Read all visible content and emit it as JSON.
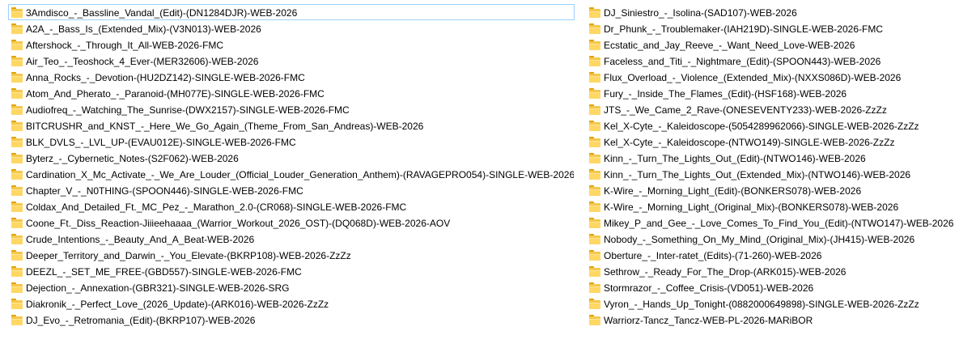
{
  "folder_icon": "folder-icon",
  "colors": {
    "folder": "#ffd765",
    "focus_border": "#99d1ff"
  },
  "focused_item": "3Amdisco_-_Bassline_Vandal_(Edit)-(DN1284DJR)-WEB-2026",
  "column_left": [
    "3Amdisco_-_Bassline_Vandal_(Edit)-(DN1284DJR)-WEB-2026",
    "A2A_-_Bass_Is_(Extended_Mix)-(V3N013)-WEB-2026",
    "Aftershock_-_Through_It_All-WEB-2026-FMC",
    "Air_Teo_-_Teoshock_4_Ever-(MER32606)-WEB-2026",
    "Anna_Rocks_-_Devotion-(HU2DZ142)-SINGLE-WEB-2026-FMC",
    "Atom_And_Pherato_-_Paranoid-(MH077E)-SINGLE-WEB-2026-FMC",
    "Audiofreq_-_Watching_The_Sunrise-(DWX2157)-SINGLE-WEB-2026-FMC",
    "BITCRUSHR_and_KNST_-_Here_We_Go_Again_(Theme_From_San_Andreas)-WEB-2026",
    "BLK_DVLS_-_LVL_UP-(EVAU012E)-SINGLE-WEB-2026-FMC",
    "Byterz_-_Cybernetic_Notes-(S2F062)-WEB-2026",
    "Cardination_X_Mc_Activate_-_We_Are_Louder_(Official_Louder_Generation_Anthem)-(RAVAGEPRO054)-SINGLE-WEB-2026-FMC",
    "Chapter_V_-_N0THING-(SPOON446)-SINGLE-WEB-2026-FMC",
    "Coldax_And_Detailed_Ft._MC_Pez_-_Marathon_2.0-(CR068)-SINGLE-WEB-2026-FMC",
    "Coone_Ft._Diss_Reaction-Jiiieehaaaa_(Warrior_Workout_2026_OST)-(DQ068D)-WEB-2026-AOV",
    "Crude_Intentions_-_Beauty_And_A_Beat-WEB-2026",
    "Deeper_Territory_and_Darwin_-_You_Elevate-(BKRP108)-WEB-2026-ZzZz",
    "DEEZL_-_SET_ME_FREE-(GBD557)-SINGLE-WEB-2026-FMC",
    "Dejection_-_Annexation-(GBR321)-SINGLE-WEB-2026-SRG",
    "Diakronik_-_Perfect_Love_(2026_Update)-(ARK016)-WEB-2026-ZzZz",
    "DJ_Evo_-_Retromania_(Edit)-(BKRP107)-WEB-2026"
  ],
  "column_right": [
    "DJ_Siniestro_-_Isolina-(SAD107)-WEB-2026",
    "Dr_Phunk_-_Troublemaker-(IAH219D)-SINGLE-WEB-2026-FMC",
    "Ecstatic_and_Jay_Reeve_-_Want_Need_Love-WEB-2026",
    "Faceless_and_Titi_-_Nightmare_(Edit)-(SPOON443)-WEB-2026",
    "Flux_Overload_-_Violence_(Extended_Mix)-(NXXS086D)-WEB-2026",
    "Fury_-_Inside_The_Flames_(Edit)-(HSF168)-WEB-2026",
    "JTS_-_We_Came_2_Rave-(ONESEVENTY233)-WEB-2026-ZzZz",
    "Kel_X-Cyte_-_Kaleidoscope-(5054289962066)-SINGLE-WEB-2026-ZzZz",
    "Kel_X-Cyte_-_Kaleidoscope-(NTWO149)-SINGLE-WEB-2026-ZzZz",
    "Kinn_-_Turn_The_Lights_Out_(Edit)-(NTWO146)-WEB-2026",
    "Kinn_-_Turn_The_Lights_Out_(Extended_Mix)-(NTWO146)-WEB-2026",
    "K-Wire_-_Morning_Light_(Edit)-(BONKERS078)-WEB-2026",
    "K-Wire_-_Morning_Light_(Original_Mix)-(BONKERS078)-WEB-2026",
    "Mikey_P_and_Gee_-_Love_Comes_To_Find_You_(Edit)-(NTWO147)-WEB-2026",
    "Nobody_-_Something_On_My_Mind_(Original_Mix)-(JH415)-WEB-2026",
    "Oberture_-_Inter-ratet_(Edits)-(71-260)-WEB-2026",
    "Sethrow_-_Ready_For_The_Drop-(ARK015)-WEB-2026",
    "Stormrazor_-_Coffee_Crisis-(VD051)-WEB-2026",
    "Vyron_-_Hands_Up_Tonight-(0882000649898)-SINGLE-WEB-2026-ZzZz",
    "Warriorz-Tancz_Tancz-WEB-PL-2026-MARiBOR"
  ]
}
